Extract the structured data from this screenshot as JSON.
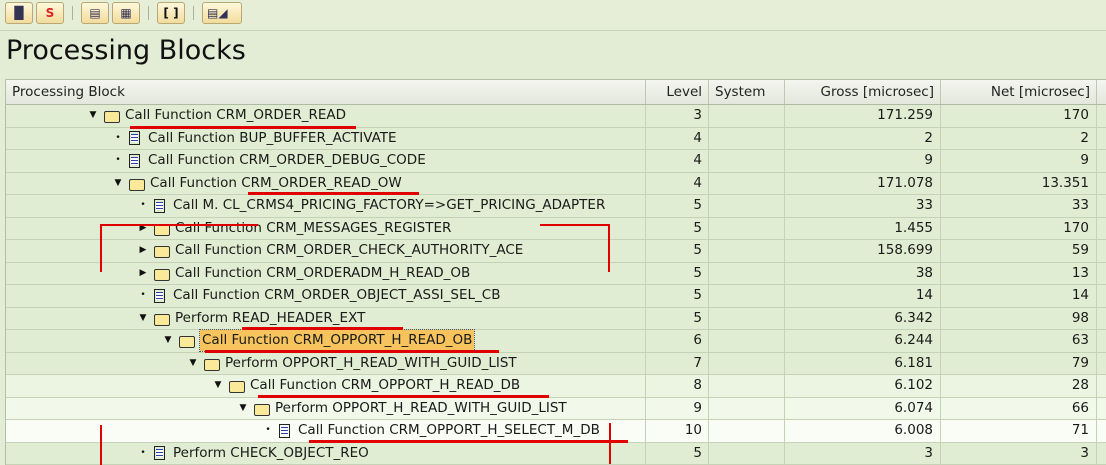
{
  "toolbar": {
    "buttons": [
      {
        "name": "binoculars-icon",
        "glyph": "▐▌"
      },
      {
        "name": "stop-icon",
        "glyph": "S"
      },
      {
        "name": "hierarchy-icon",
        "glyph": "▤"
      },
      {
        "name": "grid-icon",
        "glyph": "▦"
      },
      {
        "name": "brackets-icon",
        "glyph": "[ ]"
      },
      {
        "name": "layout-menu-icon",
        "glyph": "▤◢"
      }
    ]
  },
  "title": "Processing Blocks",
  "columns": {
    "block": "Processing Block",
    "level": "Level",
    "system": "System",
    "gross": "Gross [microsec]",
    "net": "Net [microsec]"
  },
  "rows": [
    {
      "label": "Call Function CRM_ORDER_READ",
      "level": "3",
      "gross": "171.259",
      "net": "170",
      "type": "folder",
      "expander": "expanded"
    },
    {
      "label": "Call Function BUP_BUFFER_ACTIVATE",
      "level": "4",
      "gross": "2",
      "net": "2",
      "type": "doc",
      "expander": "leaf"
    },
    {
      "label": "Call Function CRM_ORDER_DEBUG_CODE",
      "level": "4",
      "gross": "9",
      "net": "9",
      "type": "doc",
      "expander": "leaf"
    },
    {
      "label": "Call Function CRM_ORDER_READ_OW",
      "level": "4",
      "gross": "171.078",
      "net": "13.351",
      "type": "folder",
      "expander": "expanded"
    },
    {
      "label": "Call M. CL_CRMS4_PRICING_FACTORY=>GET_PRICING_ADAPTER",
      "level": "5",
      "gross": "33",
      "net": "33",
      "type": "doc",
      "expander": "leaf"
    },
    {
      "label": "Call Function CRM_MESSAGES_REGISTER",
      "level": "5",
      "gross": "1.455",
      "net": "170",
      "type": "folder",
      "expander": "collapsed"
    },
    {
      "label": "Call Function CRM_ORDER_CHECK_AUTHORITY_ACE",
      "level": "5",
      "gross": "158.699",
      "net": "59",
      "type": "folder",
      "expander": "collapsed"
    },
    {
      "label": "Call Function CRM_ORDERADM_H_READ_OB",
      "level": "5",
      "gross": "38",
      "net": "13",
      "type": "folder",
      "expander": "collapsed"
    },
    {
      "label": "Call Function CRM_ORDER_OBJECT_ASSI_SEL_CB",
      "level": "5",
      "gross": "14",
      "net": "14",
      "type": "doc",
      "expander": "leaf"
    },
    {
      "label": "Perform READ_HEADER_EXT",
      "level": "5",
      "gross": "6.342",
      "net": "98",
      "type": "folder",
      "expander": "expanded"
    },
    {
      "label": "Call Function CRM_OPPORT_H_READ_OB",
      "level": "6",
      "gross": "6.244",
      "net": "63",
      "type": "folder",
      "expander": "expanded",
      "selected": true
    },
    {
      "label": "Perform OPPORT_H_READ_WITH_GUID_LIST",
      "level": "7",
      "gross": "6.181",
      "net": "79",
      "type": "folder",
      "expander": "expanded"
    },
    {
      "label": "Call Function CRM_OPPORT_H_READ_DB",
      "level": "8",
      "gross": "6.102",
      "net": "28",
      "type": "folder",
      "expander": "expanded"
    },
    {
      "label": "Perform OPPORT_H_READ_WITH_GUID_LIST",
      "level": "9",
      "gross": "6.074",
      "net": "66",
      "type": "folder",
      "expander": "expanded"
    },
    {
      "label": "Call Function CRM_OPPORT_H_SELECT_M_DB",
      "level": "10",
      "gross": "6.008",
      "net": "71",
      "type": "doc",
      "expander": "leaf"
    },
    {
      "label": "Perform CHECK_OBJECT_REO",
      "level": "5",
      "gross": "3",
      "net": "3",
      "type": "doc",
      "expander": "leaf"
    }
  ],
  "annotation_color": "#e00000"
}
